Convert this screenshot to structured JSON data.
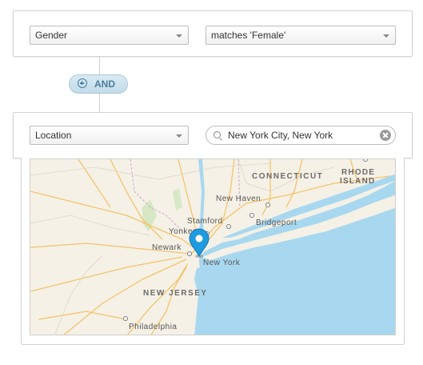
{
  "filters": [
    {
      "field": "Gender",
      "condition": "matches 'Female'"
    },
    {
      "field": "Location",
      "search": {
        "value": "New York City, New York"
      }
    }
  ],
  "and_button": {
    "label": "AND",
    "icon": "plus-circle-icon"
  },
  "map": {
    "labels": {
      "connecticut": "CONNECTICUT",
      "rhode": "RHODE",
      "island": "ISLAND",
      "new_haven": "New Haven",
      "stamford": "Stamford",
      "bridgeport": "Bridgeport",
      "yonkers": "Yonkers",
      "newark": "Newark",
      "new_york": "New York",
      "new_jersey": "NEW JERSEY",
      "philadelphia": "Philadelphia"
    },
    "marker": "map-pin-icon",
    "colors": {
      "water": "#a8d8f0",
      "land": "#f5f1e6",
      "roads": "#f6c56b",
      "pin": "#1f9be0"
    }
  }
}
